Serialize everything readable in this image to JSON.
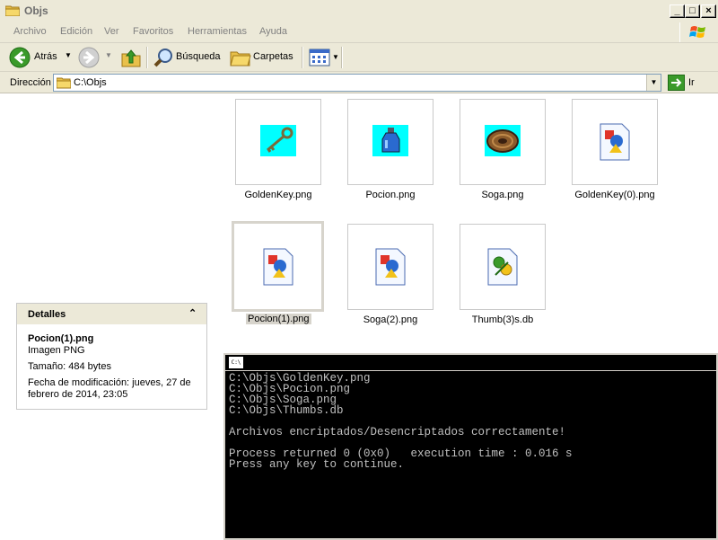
{
  "window": {
    "title": "Objs"
  },
  "menu": [
    "Archivo",
    "Edición",
    "Ver",
    "Favoritos",
    "Herramientas",
    "Ayuda"
  ],
  "toolbar": {
    "back": "Atrás",
    "search": "Búsqueda",
    "folders": "Carpetas"
  },
  "address": {
    "label": "Dirección",
    "value": "C:\\Objs",
    "go": "Ir"
  },
  "files": [
    {
      "name": "GoldenKey.png",
      "icon": "golden-key-thumbnail"
    },
    {
      "name": "Pocion.png",
      "icon": "potion-thumbnail"
    },
    {
      "name": "Soga.png",
      "icon": "rope-thumbnail"
    },
    {
      "name": "GoldenKey(0).png",
      "icon": "image-file-icon"
    },
    {
      "name": "Pocion(1).png",
      "icon": "image-file-icon",
      "selected": true
    },
    {
      "name": "Soga(2).png",
      "icon": "image-file-icon"
    },
    {
      "name": "Thumb(3)s.db",
      "icon": "thumbs-db-icon"
    }
  ],
  "details": {
    "header": "Detalles",
    "filename": "Pocion(1).png",
    "type": "Imagen PNG",
    "size": "Tamaño: 484 bytes",
    "modified": "Fecha de modificación: jueves, 27 de febrero de 2014, 23:05"
  },
  "console": {
    "icon_text": "C:\\",
    "lines": [
      "C:\\Objs\\GoldenKey.png",
      "C:\\Objs\\Pocion.png",
      "C:\\Objs\\Soga.png",
      "C:\\Objs\\Thumbs.db",
      "",
      "Archivos encriptados/Desencriptados correctamente!",
      "",
      "Process returned 0 (0x0)   execution time : 0.016 s",
      "Press any key to continue."
    ]
  }
}
